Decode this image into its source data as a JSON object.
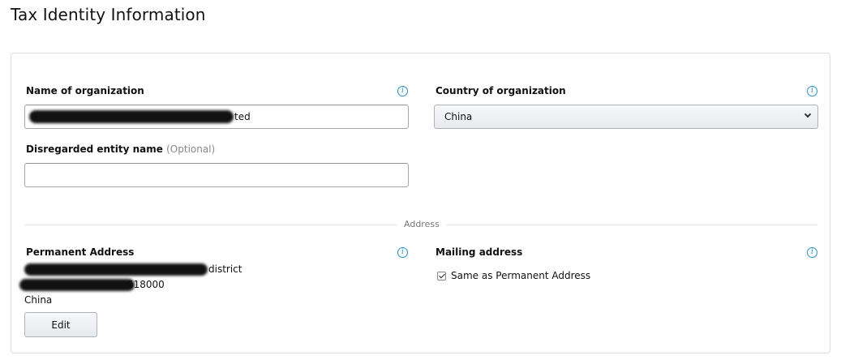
{
  "page": {
    "title": "Tax Identity Information"
  },
  "organization": {
    "name_label": "Name of organization",
    "name_value": "ted",
    "country_label": "Country of organization",
    "country_value": "China",
    "disregarded_label": "Disregarded entity name",
    "disregarded_optional": "(Optional)",
    "disregarded_value": ""
  },
  "divider": {
    "label": "Address"
  },
  "permanent_address": {
    "label": "Permanent Address",
    "line1": "district",
    "line2": "518000",
    "line3": "China",
    "edit_label": "Edit"
  },
  "mailing_address": {
    "label": "Mailing address",
    "same_as_label": "Same as Permanent Address",
    "same_as_checked": true
  },
  "icons": {
    "info": "i"
  },
  "colors": {
    "info_icon": "#2a8fc9",
    "border": "#dddddd"
  }
}
